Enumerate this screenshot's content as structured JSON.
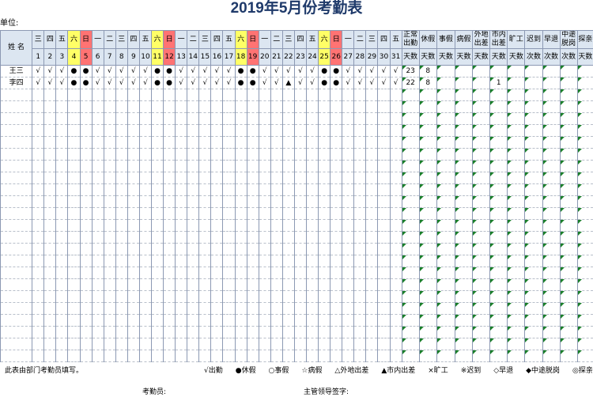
{
  "title": "2019年5月份考勤表",
  "unit_label": "单位:",
  "name_header": "姓 名",
  "weekdays": [
    "三",
    "四",
    "五",
    "六",
    "日",
    "一",
    "二",
    "三",
    "四",
    "五",
    "六",
    "日",
    "一",
    "二",
    "三",
    "四",
    "五",
    "六",
    "日",
    "一",
    "二",
    "三",
    "四",
    "五",
    "六",
    "日",
    "一",
    "二",
    "三",
    "四",
    "五"
  ],
  "dates": [
    "1",
    "2",
    "3",
    "4",
    "5",
    "6",
    "7",
    "8",
    "9",
    "10",
    "11",
    "12",
    "13",
    "14",
    "15",
    "16",
    "17",
    "18",
    "19",
    "20",
    "21",
    "22",
    "23",
    "24",
    "25",
    "26",
    "27",
    "28",
    "29",
    "30",
    "31"
  ],
  "weekend_colors": {
    "saturday": "#ffff66",
    "sunday": "#ff7373"
  },
  "summary_headers": [
    {
      "l1": "正常",
      "l2": "出勤",
      "unit": "天数"
    },
    {
      "l1": "休假",
      "l2": "",
      "unit": "天数"
    },
    {
      "l1": "事假",
      "l2": "",
      "unit": "天数"
    },
    {
      "l1": "病假",
      "l2": "",
      "unit": "天数"
    },
    {
      "l1": "外地",
      "l2": "出差",
      "unit": "天数"
    },
    {
      "l1": "市内",
      "l2": "出差",
      "unit": "天数"
    },
    {
      "l1": "旷工",
      "l2": "",
      "unit": "天数"
    },
    {
      "l1": "迟到",
      "l2": "",
      "unit": "次数"
    },
    {
      "l1": "早退",
      "l2": "",
      "unit": "次数"
    },
    {
      "l1": "中途",
      "l2": "脱岗",
      "unit": "次数"
    },
    {
      "l1": "探亲",
      "l2": "",
      "unit": "天数"
    }
  ],
  "employees": [
    {
      "name": "王三",
      "marks": [
        "√",
        "√",
        "√",
        "●",
        "●",
        "√",
        "√",
        "√",
        "√",
        "√",
        "●",
        "●",
        "√",
        "√",
        "√",
        "√",
        "√",
        "●",
        "●",
        "√",
        "√",
        "√",
        "√",
        "√",
        "●",
        "●",
        "√",
        "√",
        "√",
        "√",
        "√"
      ],
      "summary": [
        "23",
        "8",
        "",
        "",
        "",
        "",
        "",
        "",
        "",
        "",
        ""
      ]
    },
    {
      "name": "李四",
      "marks": [
        "√",
        "√",
        "√",
        "●",
        "●",
        "√",
        "√",
        "√",
        "√",
        "√",
        "●",
        "●",
        "√",
        "√",
        "√",
        "√",
        "√",
        "●",
        "●",
        "√",
        "√",
        "▲",
        "√",
        "√",
        "●",
        "●",
        "√",
        "√",
        "√",
        "√",
        "√"
      ],
      "summary": [
        "22",
        "8",
        "",
        "",
        "",
        "1",
        "",
        "",
        "",
        "",
        ""
      ]
    }
  ],
  "footer": {
    "note": "此表由部门考勤员填写。",
    "legend": [
      "√出勤",
      "●休假",
      "○事假",
      "☆病假",
      "△外地出差",
      "▲市内出差",
      "×旷工",
      "※迟到",
      "◇早退",
      "◆中途脱岗",
      "◎探亲"
    ],
    "clerk_label": "考勤员:",
    "supervisor_label": "主管领导签字:"
  }
}
